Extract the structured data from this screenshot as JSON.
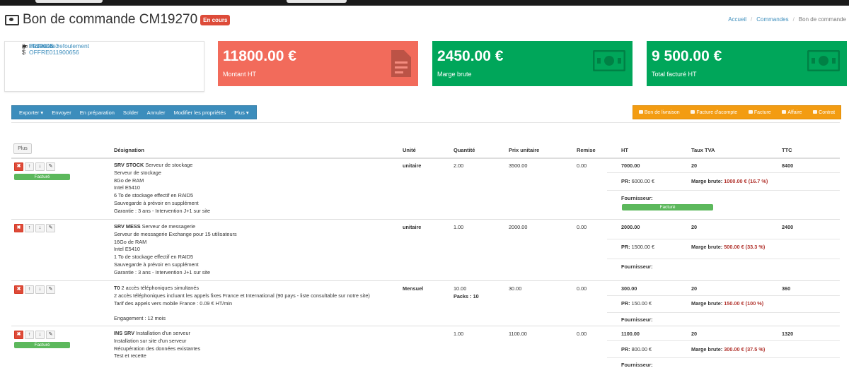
{
  "header": {
    "title": "Bon de commande CM19270",
    "status": "En cours",
    "breadcrumb": [
      "Accueil",
      "Commandes",
      "Bon de commande"
    ]
  },
  "info": {
    "offer": "OFFRE011900656",
    "category": "Postes de refoulement",
    "client": "FRANCE 3",
    "delivery": "BL19046"
  },
  "stats": [
    {
      "value": "11800.00 €",
      "label": "Montant HT",
      "color": "#f26b5b",
      "icon": "document-icon"
    },
    {
      "value": "2450.00 €",
      "label": "Marge brute",
      "color": "#00a65a",
      "icon": "money-icon"
    },
    {
      "value": "9 500.00 €",
      "label": "Total facturé HT",
      "color": "#00a65a",
      "icon": "money-icon"
    }
  ],
  "toolbar": {
    "left": [
      "Exporter ▾",
      "Envoyer",
      "En préparation",
      "Solder",
      "Annuler",
      "Modifier les propriétés",
      "Plus ▾"
    ],
    "right": [
      "Bon de livraison",
      "Facture d'acompte",
      "Facture",
      "Affaire",
      "Contrat"
    ],
    "color": "#3c8dbc",
    "right_color": "#f39c12"
  },
  "table": {
    "plus": "Plus",
    "headers": [
      "Désignation",
      "Unité",
      "Quantité",
      "Prix unitaire",
      "Remise",
      "HT",
      "Taux TVA",
      "TTC"
    ],
    "labels": {
      "pr": "PR:",
      "marge": "Marge brute:",
      "fournisseur": "Fournisseur:",
      "facture": "Facturé"
    },
    "rows": [
      {
        "code": "SRV STOCK",
        "title": "Serveur de stockage",
        "lines": [
          "Serveur de stockage",
          "8Go de RAM",
          "Intel E5410",
          "6 To de stockage effectif en RAID5",
          "Sauvegarde à prévoir en supplément",
          "Garantie : 3 ans - Intervention J+1 sur site"
        ],
        "unit": "unitaire",
        "qty": "2.00",
        "qty_extra": "",
        "price": "3500.00",
        "discount": "0.00",
        "ht": "7000.00",
        "tva": "20",
        "ttc": "8400",
        "pr": "6000.00 €",
        "marge": "1000.00 € (16.7 %)"
      },
      {
        "code": "SRV MESS",
        "title": "Serveur de messagerie",
        "lines": [
          "Serveur de messagerie Exchange pour 15 utilisateurs",
          "16Go de RAM",
          "Intel E5410",
          "1 To de stockage effectif en RAID5",
          "Sauvegarde à prévoir en supplément",
          "Garantie : 3 ans - Intervention J+1 sur site"
        ],
        "unit": "unitaire",
        "qty": "1.00",
        "qty_extra": "",
        "price": "2000.00",
        "discount": "0.00",
        "ht": "2000.00",
        "tva": "20",
        "ttc": "2400",
        "pr": "1500.00 €",
        "marge": "500.00 € (33.3 %)"
      },
      {
        "code": "T0",
        "title": "2 accès téléphoniques simultanés",
        "lines": [
          "2 accès téléphoniques incluant les appels fixes France et International (90 pays - liste consultable sur notre site)",
          "Tarif des appels vers mobile France : 0.09 € HT/min",
          "",
          "Engagement : 12 mois"
        ],
        "unit": "Mensuel",
        "qty": "10.00",
        "qty_extra": "Packs : 10",
        "price": "30.00",
        "discount": "0.00",
        "ht": "300.00",
        "tva": "20",
        "ttc": "360",
        "pr": "150.00 €",
        "marge": "150.00 € (100 %)"
      },
      {
        "code": "INS SRV",
        "title": "Installation d'un serveur",
        "lines": [
          "Installation sur site d'un serveur",
          "Récupération des données existantes",
          "Test et recette"
        ],
        "unit": "",
        "qty": "1.00",
        "qty_extra": "",
        "price": "1100.00",
        "discount": "0.00",
        "ht": "1100.00",
        "tva": "20",
        "ttc": "1320",
        "pr": "800.00 €",
        "marge": "300.00 € (37.5 %)"
      }
    ]
  }
}
